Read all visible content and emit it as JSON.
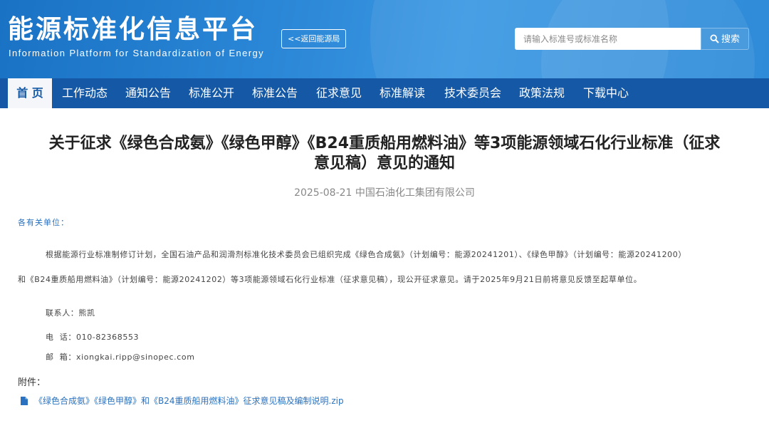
{
  "header": {
    "title": "能源标准化信息平台",
    "subtitle": "Information Platform for Standardization of Energy",
    "back_link": "<<返回能源局",
    "search_placeholder": "请输入标准号或标准名称",
    "search_button": "搜索",
    "colors": {
      "header_bg": "#2a86d6",
      "nav_bg": "#1559a6"
    }
  },
  "nav": {
    "items": [
      {
        "label": "首 页",
        "active": true
      },
      {
        "label": "工作动态"
      },
      {
        "label": "通知公告"
      },
      {
        "label": "标准公开"
      },
      {
        "label": "标准公告"
      },
      {
        "label": "征求意见"
      },
      {
        "label": "标准解读"
      },
      {
        "label": "技术委员会"
      },
      {
        "label": "政策法规"
      },
      {
        "label": "下载中心"
      }
    ]
  },
  "article": {
    "title_line1": "关于征求《绿色合成氨》《绿色甲醇》《B24重质船用燃料油》等3项能源领域石化行业标准（征求",
    "title_line2": "意见稿）意见的通知",
    "date": "2025-08-21",
    "source": "中国石油化工集团有限公司",
    "salutation": "各有关单位：",
    "body_line1": "根据能源行业标准制修订计划，全国石油产品和润滑剂标准化技术委员会已组织完成《绿色合成氨》（计划编号：能源20241201）、《绿色甲醇》（计划编号：能源20241200）",
    "body_line2": "和《B24重质船用燃料油》（计划编号：能源20241202）等3项能源领域石化行业标准（征求意见稿），现公开征求意见。请于2025年9月21日前将意见反馈至起草单位。",
    "contact": "联系人：熊凯",
    "phone": "电  话：010-82368553",
    "email": "邮  箱：xiongkai.ripp@sinopec.com",
    "attachments_label": "附件：",
    "attachment_file": "《绿色合成氨》《绿色甲醇》和《B24重质船用燃料油》征求意见稿及编制说明.zip"
  }
}
